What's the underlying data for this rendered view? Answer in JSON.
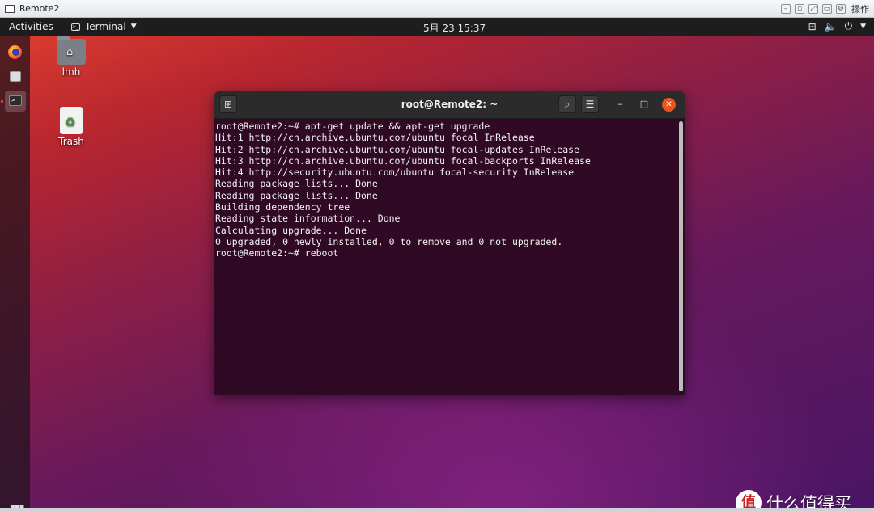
{
  "host": {
    "title": "Remote2",
    "op_label": "操作"
  },
  "panel": {
    "activities": "Activities",
    "app_menu": "Terminal",
    "clock": "5月 23  15:37"
  },
  "desktop": {
    "home_label": "lmh",
    "trash_label": "Trash"
  },
  "terminal": {
    "title": "root@Remote2: ~",
    "output": "root@Remote2:~# apt-get update && apt-get upgrade\nHit:1 http://cn.archive.ubuntu.com/ubuntu focal InRelease\nHit:2 http://cn.archive.ubuntu.com/ubuntu focal-updates InRelease\nHit:3 http://cn.archive.ubuntu.com/ubuntu focal-backports InRelease\nHit:4 http://security.ubuntu.com/ubuntu focal-security InRelease\nReading package lists... Done\nReading package lists... Done\nBuilding dependency tree\nReading state information... Done\nCalculating upgrade... Done\n0 upgraded, 0 newly installed, 0 to remove and 0 not upgraded.\nroot@Remote2:~# reboot"
  },
  "watermark": {
    "badge": "值",
    "text": "什么值得买"
  },
  "colors": {
    "terminal_bg": "#300a24",
    "accent": "#e95420"
  }
}
